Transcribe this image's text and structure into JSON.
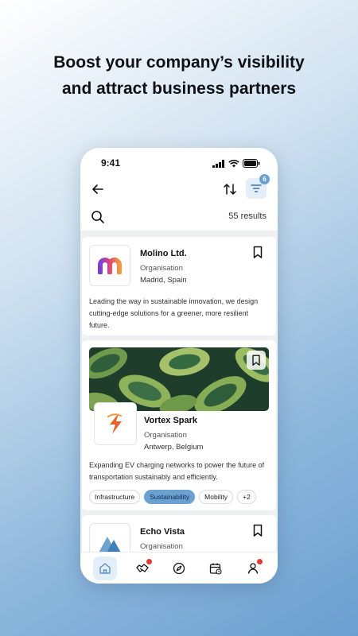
{
  "headline": {
    "line1": "Boost your company’s visibility",
    "line2": "and attract business partners"
  },
  "status_bar": {
    "time": "9:41"
  },
  "top_bar": {
    "filter_count": "6"
  },
  "search": {
    "results_label": "55 results"
  },
  "cards": [
    {
      "name": "Molino Ltd.",
      "type": "Organisation",
      "location": "Madrid, Spain",
      "description": "Leading the way in sustainable innovation, we design cutting-edge solutions for a greener, more resilient future."
    },
    {
      "name": "Vortex Spark",
      "type": "Organisation",
      "location": "Antwerp, Belgium",
      "description": "Expanding EV charging networks to power the future of transportation sustainably and efficiently.",
      "tags": [
        "Infrastructure",
        "Sustainability",
        "Mobility",
        "+2"
      ]
    },
    {
      "name": "Echo Vista",
      "type": "Organisation"
    }
  ],
  "nav": {
    "items": [
      "home-icon",
      "handshake-icon",
      "compass-icon",
      "calendar-icon",
      "profile-icon"
    ],
    "active": "home-icon"
  },
  "colors": {
    "accent": "#6ba1d1",
    "accent_light": "#e3eef8",
    "notification": "#e53935"
  }
}
